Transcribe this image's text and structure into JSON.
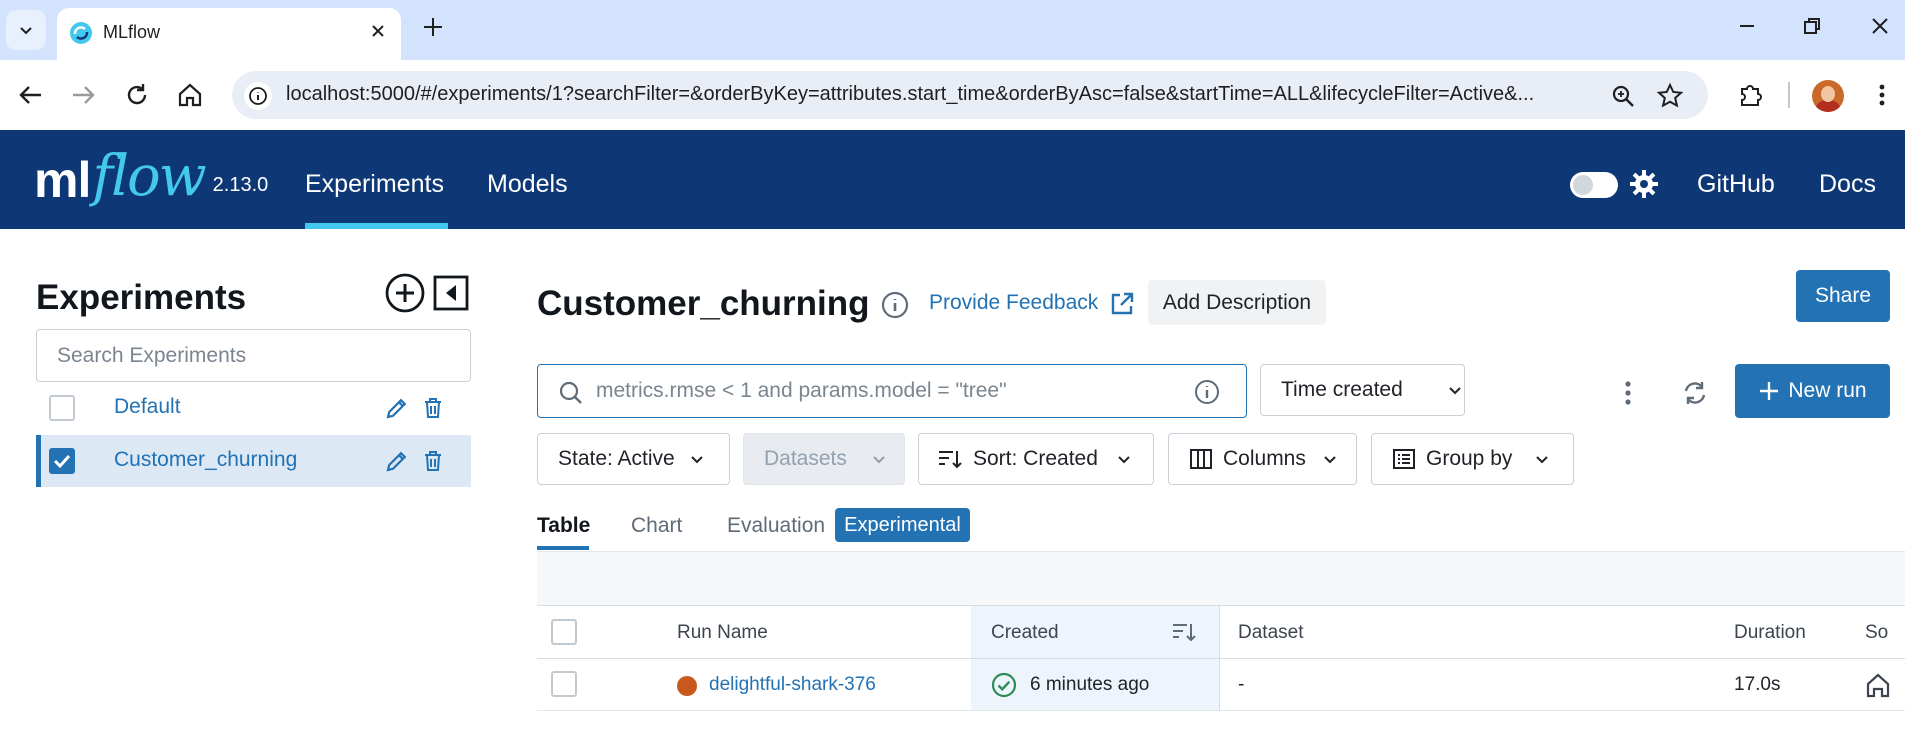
{
  "browser": {
    "tab_title": "MLflow",
    "url": "localhost:5000/#/experiments/1?searchFilter=&orderByKey=attributes.start_time&orderByAsc=false&startTime=ALL&lifecycleFilter=Active&..."
  },
  "header": {
    "logo_ml": "ml",
    "logo_flow": "flow",
    "version": "2.13.0",
    "nav": [
      "Experiments",
      "Models"
    ],
    "links": [
      "GitHub",
      "Docs"
    ]
  },
  "sidebar": {
    "title": "Experiments",
    "search_placeholder": "Search Experiments",
    "experiments": [
      {
        "name": "Default",
        "checked": false
      },
      {
        "name": "Customer_churning",
        "checked": true
      }
    ]
  },
  "main": {
    "title": "Customer_churning",
    "feedback": "Provide Feedback",
    "add_description": "Add Description",
    "share": "Share",
    "search_placeholder": "metrics.rmse < 1 and params.model = \"tree\"",
    "time_filter": "Time created",
    "new_run": "New run",
    "filters": {
      "state": "State: Active",
      "datasets": "Datasets",
      "sort": "Sort: Created",
      "columns": "Columns",
      "group_by": "Group by"
    },
    "view_tabs": [
      "Table",
      "Chart",
      "Evaluation"
    ],
    "experimental_badge": "Experimental"
  },
  "table": {
    "columns": [
      "Run Name",
      "Created",
      "Dataset",
      "Duration",
      "So"
    ],
    "rows": [
      {
        "run_name": "delightful-shark-376",
        "created": "6 minutes ago",
        "dataset": "-",
        "duration": "17.0s",
        "status": "success"
      }
    ]
  },
  "colors": {
    "header_bg": "#0e3776",
    "accent": "#2272b4",
    "logo_flow": "#43c9ed",
    "run_color": "#c9581f",
    "success": "#2e8b57"
  }
}
